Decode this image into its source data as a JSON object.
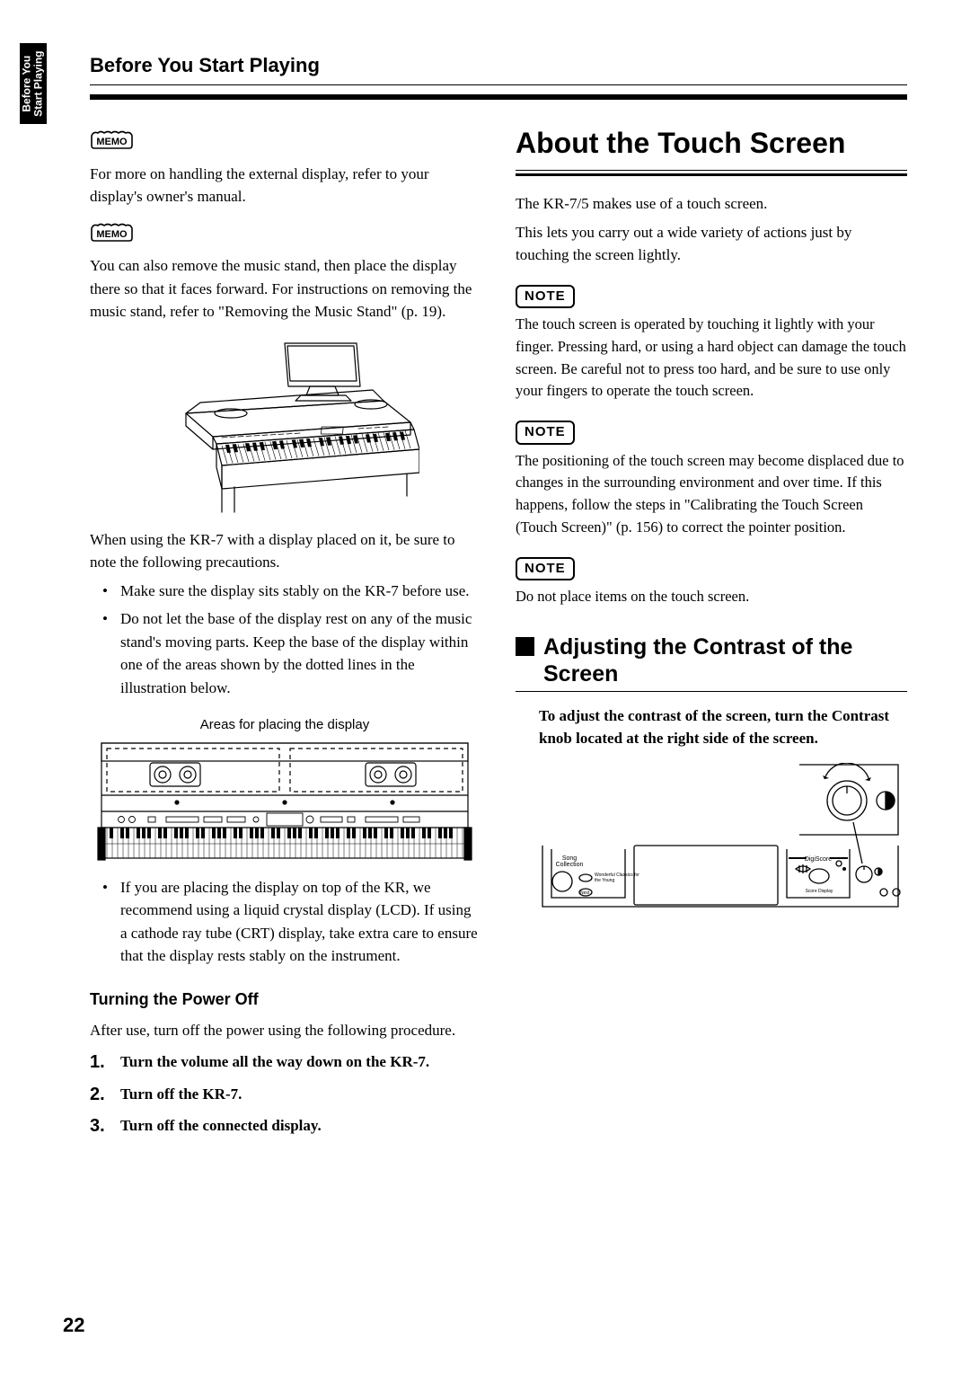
{
  "sideTab": {
    "line1": "Before You",
    "line2": "Start Playing"
  },
  "runningHead": "Before You Start Playing",
  "left": {
    "memo1": "For more on handling the external display, refer to your display's owner's manual.",
    "memo2": "You can also remove the music stand, then place the display there so that it faces forward. For instructions on removing the music stand, refer to \"Removing the Music Stand\" (p. 19).",
    "precautionsIntro": "When using the KR-7 with a display placed on it, be sure to note the following precautions.",
    "bullets": [
      "Make sure the display sits stably on the KR-7 before use.",
      "Do not let the base of the display rest on any of the music stand's moving parts. Keep the base of the display within one of the areas shown by the dotted lines in the illustration below."
    ],
    "figCaption": "Areas for placing the display",
    "bullet3": "If you are placing the display on top of the KR, we recommend using a liquid crystal display (LCD). If using a cathode ray tube (CRT) display, take extra care to ensure that the display rests stably on the instrument.",
    "powerOffHeading": "Turning the Power Off",
    "powerOffIntro": "After use, turn off the power using the following procedure.",
    "steps": [
      "Turn the volume all the way down on the KR-7.",
      "Turn off the KR-7.",
      "Turn off the connected display."
    ]
  },
  "right": {
    "h1": "About the Touch Screen",
    "intro1": "The KR-7/5 makes use of a touch screen.",
    "intro2": "This lets you carry out a wide variety of actions just by touching the screen lightly.",
    "noteLabel": "NOTE",
    "note1": "The touch screen is operated by touching it lightly with your finger. Pressing hard, or using a hard object can damage the touch screen. Be careful not to press too hard, and be sure to use only your fingers to operate the touch screen.",
    "note2": "The positioning of the touch screen may become displaced due to changes in the surrounding environment and over time. If this happens, follow the steps in \"Calibrating the Touch Screen (Touch Screen)\" (p. 156) to correct the pointer position.",
    "note3": "Do not place items on the touch screen.",
    "h2": "Adjusting the Contrast of the Screen",
    "adjustPara": "To adjust the contrast of the screen, turn the Contrast knob located at the right side of the screen.",
    "panel": {
      "leftLabel1": "Song",
      "leftLabel2": "Collection",
      "leftBtn1a": "Wonderful Classics for",
      "leftBtn1b": "the Young",
      "leftBtn2": "Next",
      "rightLabel": "DigiScore",
      "rightBtn": "Score Display"
    }
  },
  "pageNumber": "22"
}
